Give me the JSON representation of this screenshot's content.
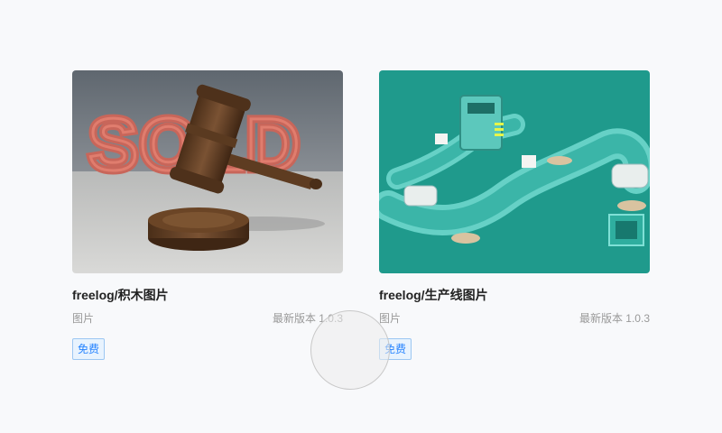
{
  "cards": [
    {
      "title": "freelog/积木图片",
      "type": "图片",
      "version": "最新版本 1.0.3",
      "price_tag": "免费",
      "thumbnail_icon": "gavel-sold-image"
    },
    {
      "title": "freelog/生产线图片",
      "type": "图片",
      "version": "最新版本 1.0.3",
      "price_tag": "免费",
      "thumbnail_icon": "conveyor-belt-image"
    }
  ],
  "colors": {
    "tag_text": "#2784ff",
    "tag_bg": "#e8f3fe",
    "tag_border": "#9cc7f2",
    "background": "#f8f9fb"
  }
}
